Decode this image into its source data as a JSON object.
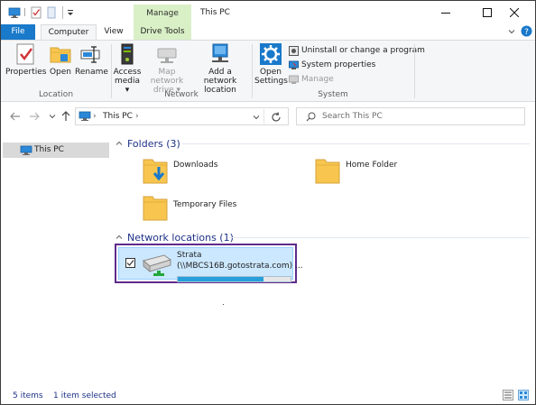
{
  "titlebar": {
    "title": "This PC",
    "context_tab": "Manage",
    "controls": [
      "minimize-icon",
      "maximize-icon",
      "close-icon"
    ]
  },
  "ribbon_tabs": [
    {
      "label": "File"
    },
    {
      "label": "Computer"
    },
    {
      "label": "View"
    },
    {
      "label": "Drive Tools"
    }
  ],
  "ribbon": {
    "groups": {
      "location": {
        "label": "Location",
        "buttons": [
          {
            "label": "Properties",
            "icon": "properties-icon"
          },
          {
            "label": "Open",
            "icon": "open-folder-icon"
          },
          {
            "label": "Rename",
            "icon": "rename-icon"
          }
        ]
      },
      "network": {
        "label": "Network",
        "access_media": {
          "line1": "Access",
          "line2": "media ▾"
        },
        "map_drive": {
          "line1": "Map network",
          "line2": "drive ▾"
        },
        "add_location": {
          "line1": "Add a network",
          "line2": "location"
        }
      },
      "system": {
        "label": "System",
        "open_settings": {
          "line1": "Open",
          "line2": "Settings"
        },
        "items": [
          {
            "label": "Uninstall or change a program",
            "disabled": false
          },
          {
            "label": "System properties",
            "disabled": false
          },
          {
            "label": "Manage",
            "disabled": true
          }
        ]
      }
    }
  },
  "address": {
    "path": "This PC",
    "separator": "›",
    "search_placeholder": "Search This PC"
  },
  "nav_pane": {
    "selected": "This PC"
  },
  "content": {
    "folders_header": "Folders (3)",
    "folders": [
      {
        "name": "Downloads",
        "icon": "downloads-folder-icon"
      },
      {
        "name": "Home Folder",
        "icon": "folder-icon"
      },
      {
        "name": "Temporary Files",
        "icon": "folder-icon"
      }
    ],
    "network_header": "Network locations (1)",
    "network_locations": [
      {
        "name": "Strata",
        "path": "(\\\\MBCS16B.gotostrata.com) ...",
        "selected": true,
        "checked": true,
        "usage_fraction": 0.76
      }
    ]
  },
  "status": {
    "item_count": "5 items",
    "selection": "1 item selected"
  },
  "colors": {
    "accent": "#1979ca",
    "manage_tab": "#d9f0c6",
    "selection_fill": "#cce8ff",
    "highlight_border": "#5e2b8c",
    "group_header": "#1e3287",
    "drive_bar": "#26a0da"
  }
}
